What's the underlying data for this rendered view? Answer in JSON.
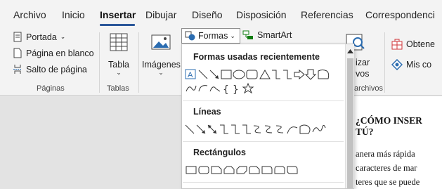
{
  "tabs": [
    {
      "label": "Archivo"
    },
    {
      "label": "Inicio"
    },
    {
      "label": "Insertar"
    },
    {
      "label": "Dibujar"
    },
    {
      "label": "Diseño"
    },
    {
      "label": "Disposición"
    },
    {
      "label": "Referencias"
    },
    {
      "label": "Correspondenci"
    }
  ],
  "active_tab": "Insertar",
  "groups": {
    "paginas": {
      "label": "Páginas",
      "portada": "Portada",
      "pagina_en_blanco": "Página en blanco",
      "salto_de_pagina": "Salto de página"
    },
    "tablas": {
      "label": "Tablas",
      "tabla": "Tabla"
    },
    "ilustraciones": {
      "imagenes": "Imágenes",
      "formas": "Formas",
      "smartart": "SmartArt"
    },
    "archivos": {
      "label_partial": "archivos",
      "text_partial_1": "izar",
      "text_partial_2": "vos"
    },
    "complementos": {
      "obtener": "Obtene",
      "mis_complementos": "Mis co"
    }
  },
  "shapes_dropdown": {
    "sections": [
      {
        "heading": "Formas usadas recientemente"
      },
      {
        "heading": "Líneas"
      },
      {
        "heading": "Rectángulos"
      }
    ]
  },
  "document": {
    "title": "¿CÓMO INSER\nTÚ?",
    "lines": [
      "anera más rápida",
      "caracteres de mar",
      "teres que se puede"
    ]
  },
  "colors": {
    "accent": "#2b579a",
    "ribbon_bg": "#f3f3f3",
    "doc_bg": "#e3e3e3",
    "icon_blue": "#2b6cb0",
    "icon_red": "#d13438"
  }
}
